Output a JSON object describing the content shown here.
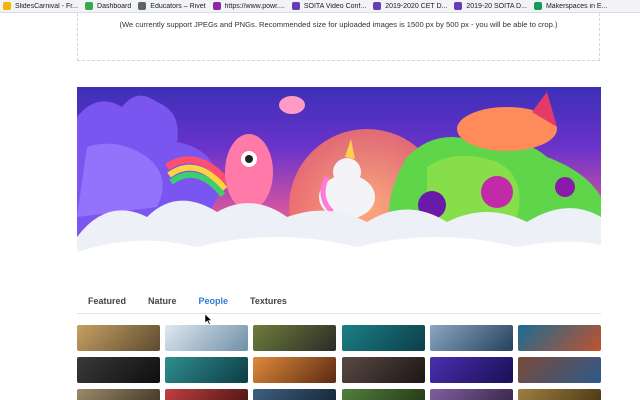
{
  "bookmarks": [
    {
      "label": "SlidesCarnival - Fr...",
      "icon": "slides-icon",
      "color": "#f4b400"
    },
    {
      "label": "Dashboard",
      "icon": "dashboard-icon",
      "color": "#34a853"
    },
    {
      "label": "Educators – Rivet",
      "icon": "rivet-icon",
      "color": "#5f6368"
    },
    {
      "label": "https://www.powr....",
      "icon": "globe-icon",
      "color": "#8e24aa"
    },
    {
      "label": "SOITA Video Conf...",
      "icon": "form-icon",
      "color": "#673ab7"
    },
    {
      "label": "2019-2020 CET D...",
      "icon": "form-icon",
      "color": "#673ab7"
    },
    {
      "label": "2019-20 SOITA D...",
      "icon": "form-icon",
      "color": "#673ab7"
    },
    {
      "label": "Makerspaces in E...",
      "icon": "sheets-icon",
      "color": "#0f9d58"
    }
  ],
  "upload": {
    "note": "(We currently support JPEGs and PNGs. Recommended size for uploaded images is 1500 px by 500 px - you will be able to crop.)"
  },
  "tabs": [
    {
      "label": "Featured",
      "active": false
    },
    {
      "label": "Nature",
      "active": false
    },
    {
      "label": "People",
      "active": true
    },
    {
      "label": "Textures",
      "active": false
    }
  ],
  "thumbnails": [
    {
      "c1": "#c7a062",
      "c2": "#5c4a30"
    },
    {
      "c1": "#dfe8f0",
      "c2": "#6f8fa8"
    },
    {
      "c1": "#6f7d3a",
      "c2": "#2b2b28"
    },
    {
      "c1": "#1c7f86",
      "c2": "#0c3e4a"
    },
    {
      "c1": "#8aa6c2",
      "c2": "#26415e"
    },
    {
      "c1": "#1a6b93",
      "c2": "#c2522e"
    },
    {
      "c1": "#3a3a3a",
      "c2": "#0e0e0e"
    },
    {
      "c1": "#2e8f8f",
      "c2": "#0d3b45"
    },
    {
      "c1": "#e08a3a",
      "c2": "#5a2a12"
    },
    {
      "c1": "#5a4a44",
      "c2": "#1c1514"
    },
    {
      "c1": "#4a2fb0",
      "c2": "#1a0f55"
    },
    {
      "c1": "#7a4a3a",
      "c2": "#2d5a8a"
    },
    {
      "c1": "#9a8a6a",
      "c2": "#3a3020"
    },
    {
      "c1": "#c04040",
      "c2": "#401010"
    },
    {
      "c1": "#406080",
      "c2": "#102030"
    },
    {
      "c1": "#508040",
      "c2": "#203010"
    },
    {
      "c1": "#8060a0",
      "c2": "#302040"
    },
    {
      "c1": "#a08040",
      "c2": "#403010"
    }
  ]
}
